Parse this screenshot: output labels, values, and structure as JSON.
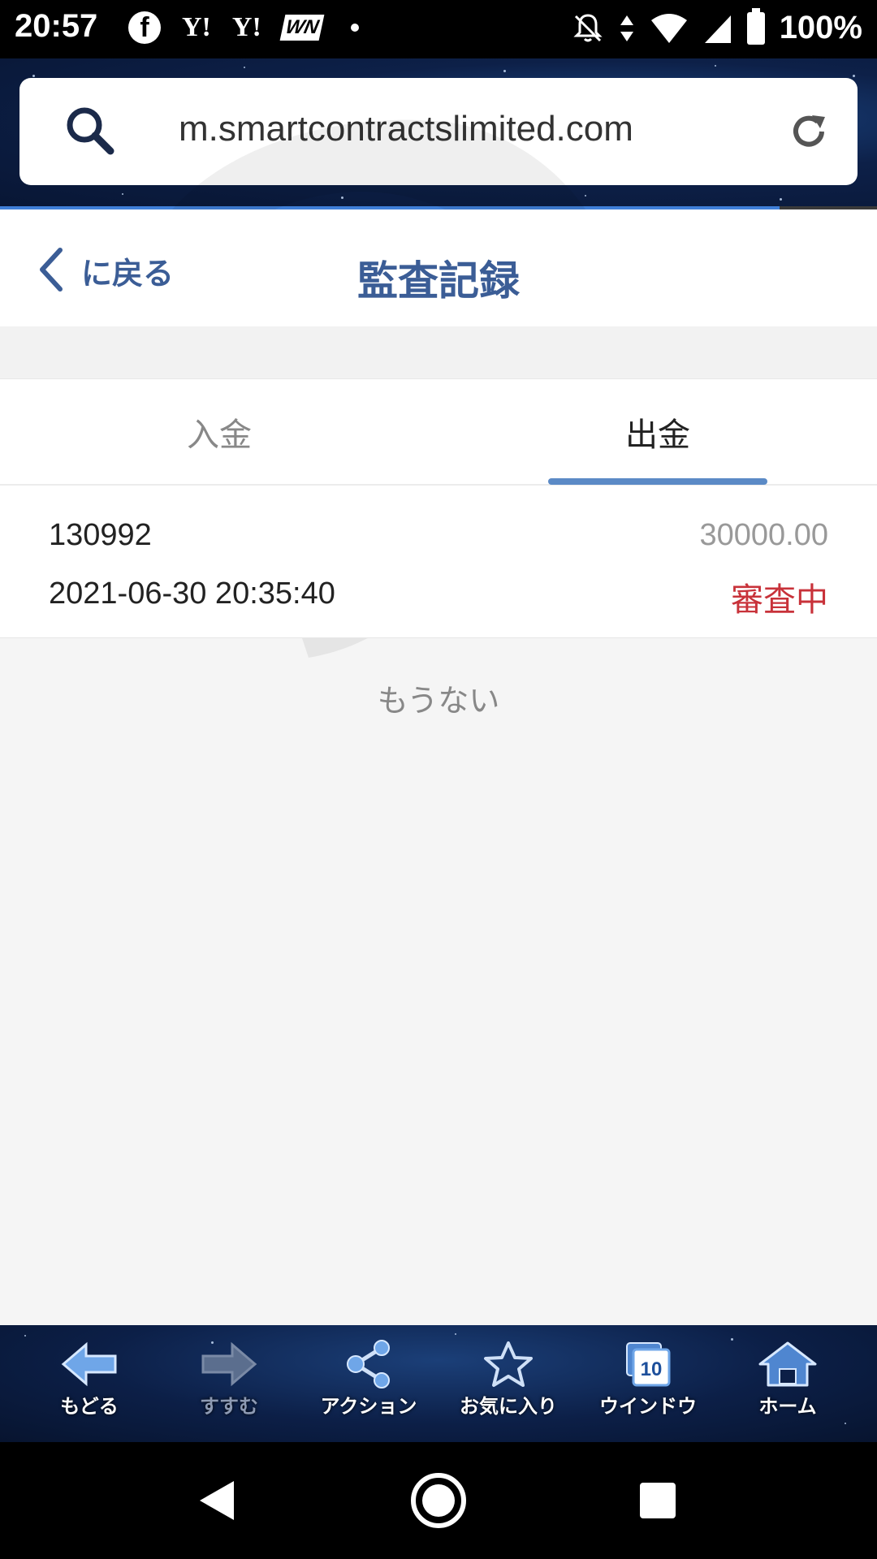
{
  "status_bar": {
    "time": "20:57",
    "battery": "100%",
    "notif_y1": "Y!",
    "notif_y2": "Y!",
    "notif_wn": "WN"
  },
  "browser": {
    "url": "m.smartcontractslimited.com"
  },
  "header": {
    "back_label": "に戻る",
    "title": "監査記録"
  },
  "tabs": [
    {
      "label": "入金",
      "active": false
    },
    {
      "label": "出金",
      "active": true
    }
  ],
  "records": [
    {
      "id": "130992",
      "amount": "30000.00",
      "datetime": "2021-06-30 20:35:40",
      "status": "審査中"
    }
  ],
  "list_end_text": "もうない",
  "toolbar": {
    "back": "もどる",
    "forward": "すすむ",
    "action": "アクション",
    "favorites": "お気に入り",
    "windows": "ウインドウ",
    "window_count": "10",
    "home": "ホーム"
  },
  "colors": {
    "accent": "#3b5d96",
    "tab_indicator": "#5b8ac6",
    "status_pending": "#c8323a"
  }
}
